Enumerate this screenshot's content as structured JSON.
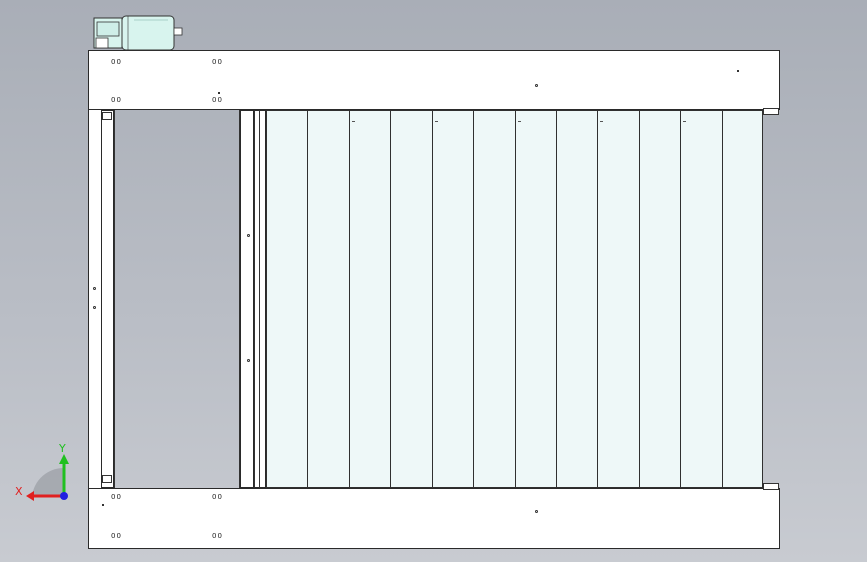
{
  "viewport": {
    "background": "#b4b8c0",
    "slat_color": "#eef8f8",
    "motor_color": "#d8f4ee",
    "slat_count": 12
  },
  "top_beam": {
    "hole_labels": [
      "00",
      "00",
      "00",
      "00"
    ]
  },
  "bottom_beam": {
    "hole_labels": [
      "00",
      "00",
      "00",
      "00"
    ]
  },
  "triad": {
    "x_label": "X",
    "y_label": "Y",
    "x_color": "#e02020",
    "y_color": "#20c020",
    "z_color": "#2020e0"
  }
}
